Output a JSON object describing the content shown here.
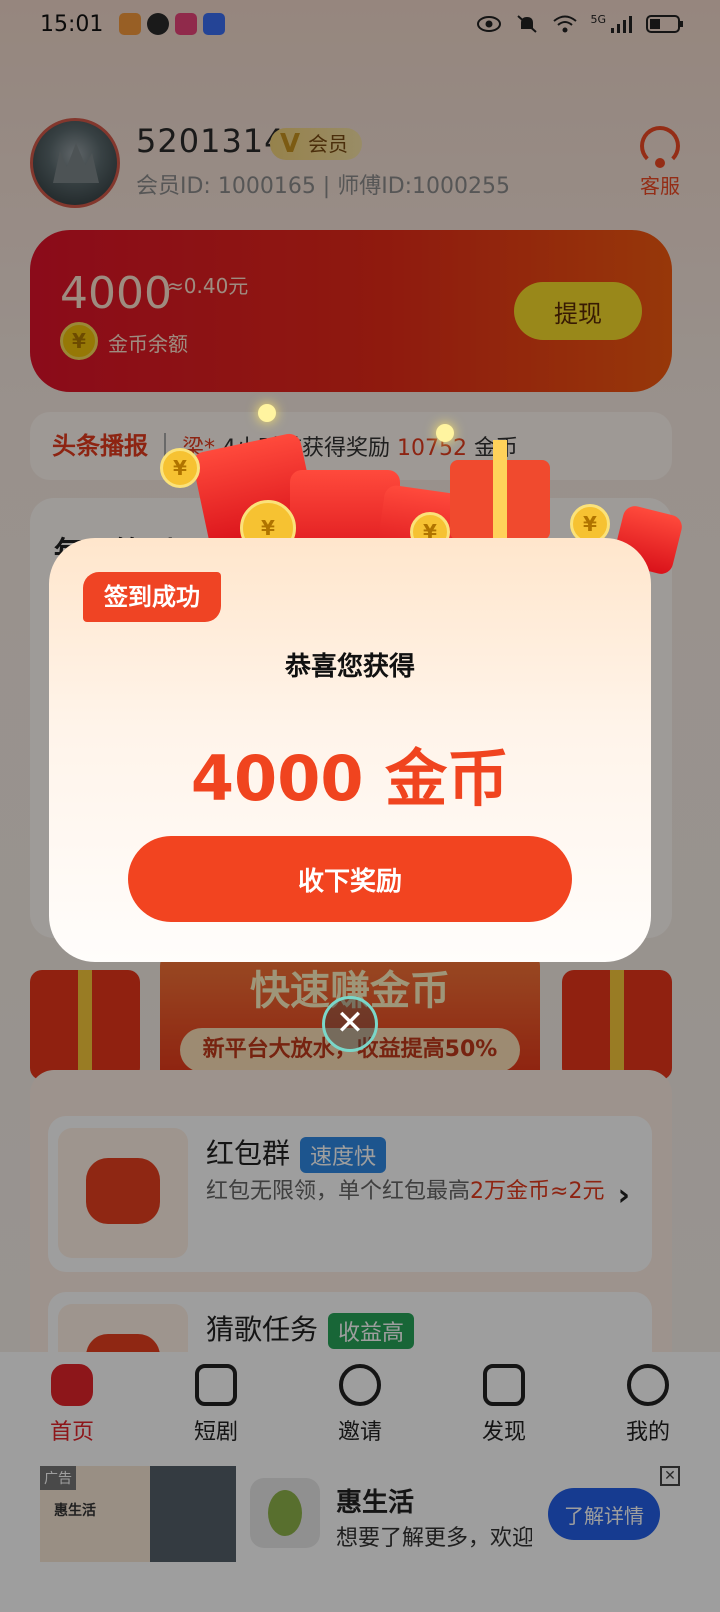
{
  "status_bar": {
    "time": "15:01",
    "network": "5G"
  },
  "profile": {
    "nickname": "5201314",
    "vip_label": "会员",
    "vip_icon": "V",
    "ids_text": "会员ID: 1000165 | 师傅ID:1000255",
    "service_label": "客服"
  },
  "balance": {
    "amount": "4000",
    "rmb": "≈0.40元",
    "coin_symbol": "¥",
    "label": "金币余额",
    "withdraw_label": "提现"
  },
  "ticker": {
    "label": "头条播报",
    "user": "梁*",
    "text": "4小时前获得奖励",
    "amount": "10752",
    "unit": "金币"
  },
  "daily_card": {
    "title": "每日签到"
  },
  "banner": {
    "title": "快速赚金币",
    "subtitle": "新平台大放水，收益提高50%"
  },
  "tasks": [
    {
      "name": "红包群",
      "tag": "速度快",
      "desc_prefix": "红包无限领，单个红包最高",
      "desc_highlight": "2万金币≈2元"
    },
    {
      "name": "猜歌任务",
      "tag": "收益高"
    }
  ],
  "bottom_nav": [
    {
      "label": "首页",
      "active": true
    },
    {
      "label": "短剧",
      "active": false
    },
    {
      "label": "邀请",
      "active": false
    },
    {
      "label": "发现",
      "active": false
    },
    {
      "label": "我的",
      "active": false
    }
  ],
  "ad": {
    "badge": "广告",
    "thumb_title": "惠生活",
    "title": "惠生活",
    "text": "想要了解更多，欢迎",
    "cta": "了解详情",
    "close_symbol": "✕"
  },
  "modal": {
    "tag": "签到成功",
    "heading": "恭喜您获得",
    "amount": "4000 金币",
    "button": "收下奖励",
    "close_symbol": "✕",
    "coin_symbol": "¥"
  },
  "colors": {
    "accent": "#f24420",
    "nav_active": "#e4242a",
    "vip_gold": "#f3d27a",
    "cta_blue": "#2460e8"
  }
}
